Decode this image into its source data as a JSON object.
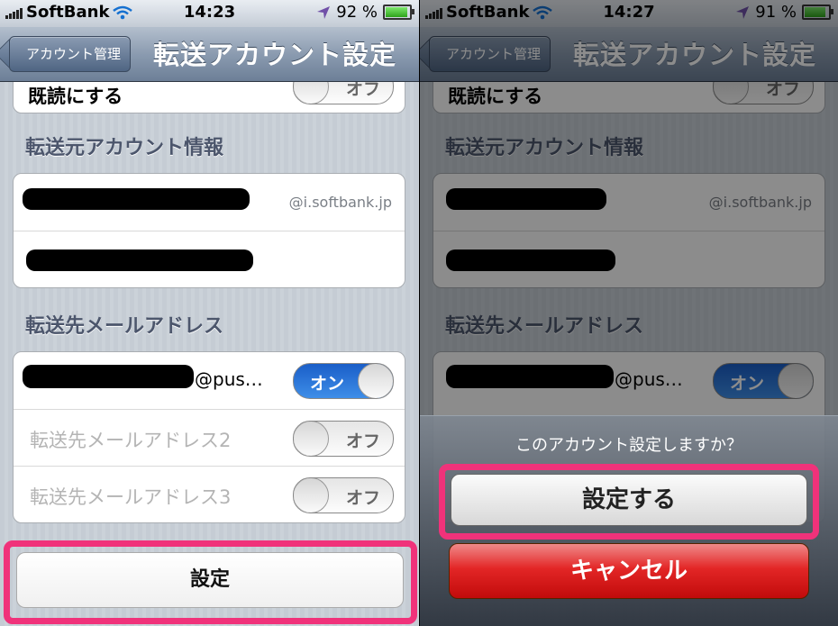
{
  "status_left": {
    "carrier": "SoftBank",
    "time": "14:23",
    "battery": "92 %",
    "battery_level": 0.92
  },
  "status_right": {
    "carrier": "SoftBank",
    "time": "14:27",
    "battery": "91 %",
    "battery_level": 0.91
  },
  "nav": {
    "back_label": "アカウント管理",
    "title": "転送アカウント設定"
  },
  "top_row": {
    "label": "既読にする",
    "toggle": "オフ"
  },
  "source_section": {
    "header": "転送元アカウント情報",
    "domain": "@i.softbank.jp"
  },
  "dest_section": {
    "header": "転送先メールアドレス",
    "rows": [
      {
        "label": "@pus…",
        "toggle": "オン",
        "state": "on"
      },
      {
        "label": "転送先メールアドレス2",
        "toggle": "オフ",
        "state": "off"
      },
      {
        "label": "転送先メールアドレス3",
        "toggle": "オフ",
        "state": "off"
      }
    ]
  },
  "settings_button": "設定",
  "action_sheet": {
    "prompt": "このアカウント設定しますか？",
    "confirm": "設定する",
    "cancel": "キャンセル"
  },
  "colors": {
    "highlight": "#f0327a",
    "toggle_on": "#2f7de0",
    "cancel_red": "#d91a1a"
  },
  "icons": [
    "signal-bars-icon",
    "wifi-icon",
    "location-arrow-icon",
    "battery-icon",
    "back-chevron-icon"
  ]
}
